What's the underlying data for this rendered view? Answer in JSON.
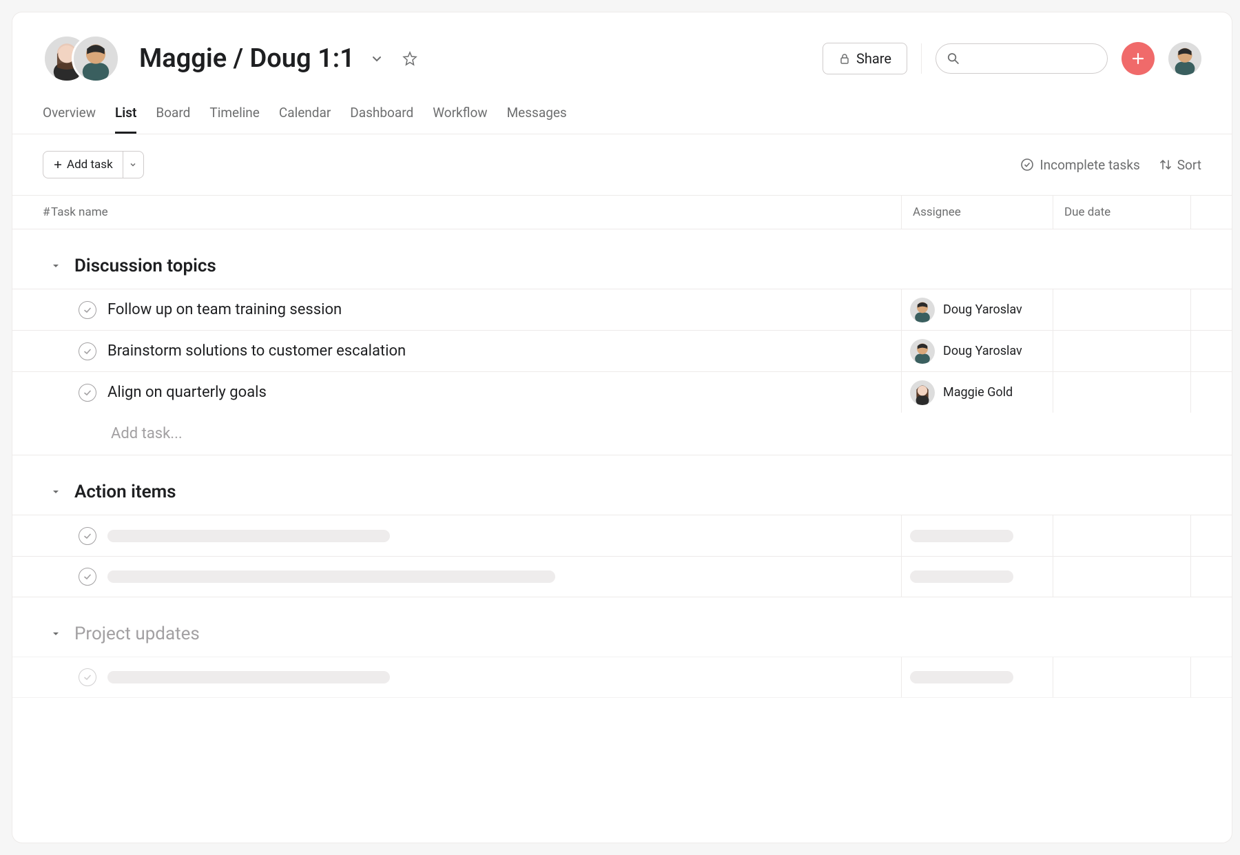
{
  "header": {
    "project_title": "Maggie / Doug 1:1",
    "share_label": "Share",
    "search_placeholder": ""
  },
  "tabs": [
    "Overview",
    "List",
    "Board",
    "Timeline",
    "Calendar",
    "Dashboard",
    "Workflow",
    "Messages"
  ],
  "active_tab_index": 1,
  "toolbar": {
    "add_task_label": "Add task",
    "filter_label": "Incomplete tasks",
    "sort_label": "Sort"
  },
  "columns": {
    "num": "#",
    "task_name": "Task name",
    "assignee": "Assignee",
    "due_date": "Due date"
  },
  "sections": [
    {
      "title": "Discussion topics",
      "tasks": [
        {
          "name": "Follow up on team training session",
          "assignee": "Doug Yaroslav",
          "avatar": "doug"
        },
        {
          "name": "Brainstorm solutions to customer escalation",
          "assignee": "Doug Yaroslav",
          "avatar": "doug"
        },
        {
          "name": "Align on quarterly goals",
          "assignee": "Maggie Gold",
          "avatar": "maggie"
        }
      ],
      "add_task_placeholder": "Add task..."
    },
    {
      "title": "Action items",
      "skeleton_tasks": [
        {
          "name_width": 410,
          "has_assignee_skeleton": true
        },
        {
          "name_width": 650,
          "has_assignee_skeleton": true
        }
      ]
    },
    {
      "title": "Project updates",
      "faded": true,
      "skeleton_tasks": [
        {
          "name_width": 410,
          "has_assignee_skeleton": true
        }
      ]
    }
  ]
}
